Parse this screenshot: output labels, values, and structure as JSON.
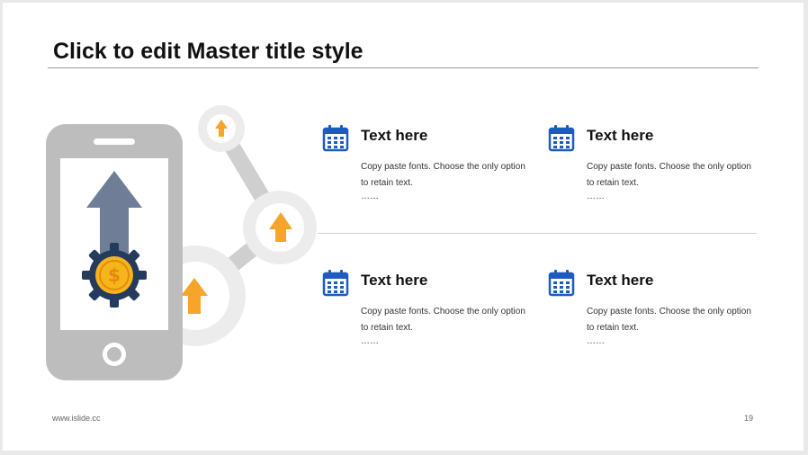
{
  "slide": {
    "title": "Click to edit Master title style",
    "footer_url": "www.islide.cc",
    "page_number": "19"
  },
  "blocks": [
    {
      "heading": "Text here",
      "body": "Copy paste fonts. Choose the only option to retain text.",
      "ellipsis": "……"
    },
    {
      "heading": "Text here",
      "body": "Copy paste fonts. Choose the only option to retain text.",
      "ellipsis": "……"
    },
    {
      "heading": "Text here",
      "body": "Copy paste fonts. Choose the only option to retain text.",
      "ellipsis": "……"
    },
    {
      "heading": "Text here",
      "body": "Copy paste fonts. Choose the only option to retain text.",
      "ellipsis": "……"
    }
  ],
  "icons": {
    "block_icon": "calendar-icon",
    "phone": "smartphone-icon",
    "gear": "dollar-gear-icon",
    "arrows": "up-arrow-icon"
  },
  "colors": {
    "accent_blue": "#1d5bbf",
    "arrow_orange": "#f7a42b",
    "phone_gray": "#bdbdbd",
    "arrow_slate": "#6f7e96",
    "gear_navy": "#253b5e",
    "coin_gold": "#f5b51b"
  }
}
